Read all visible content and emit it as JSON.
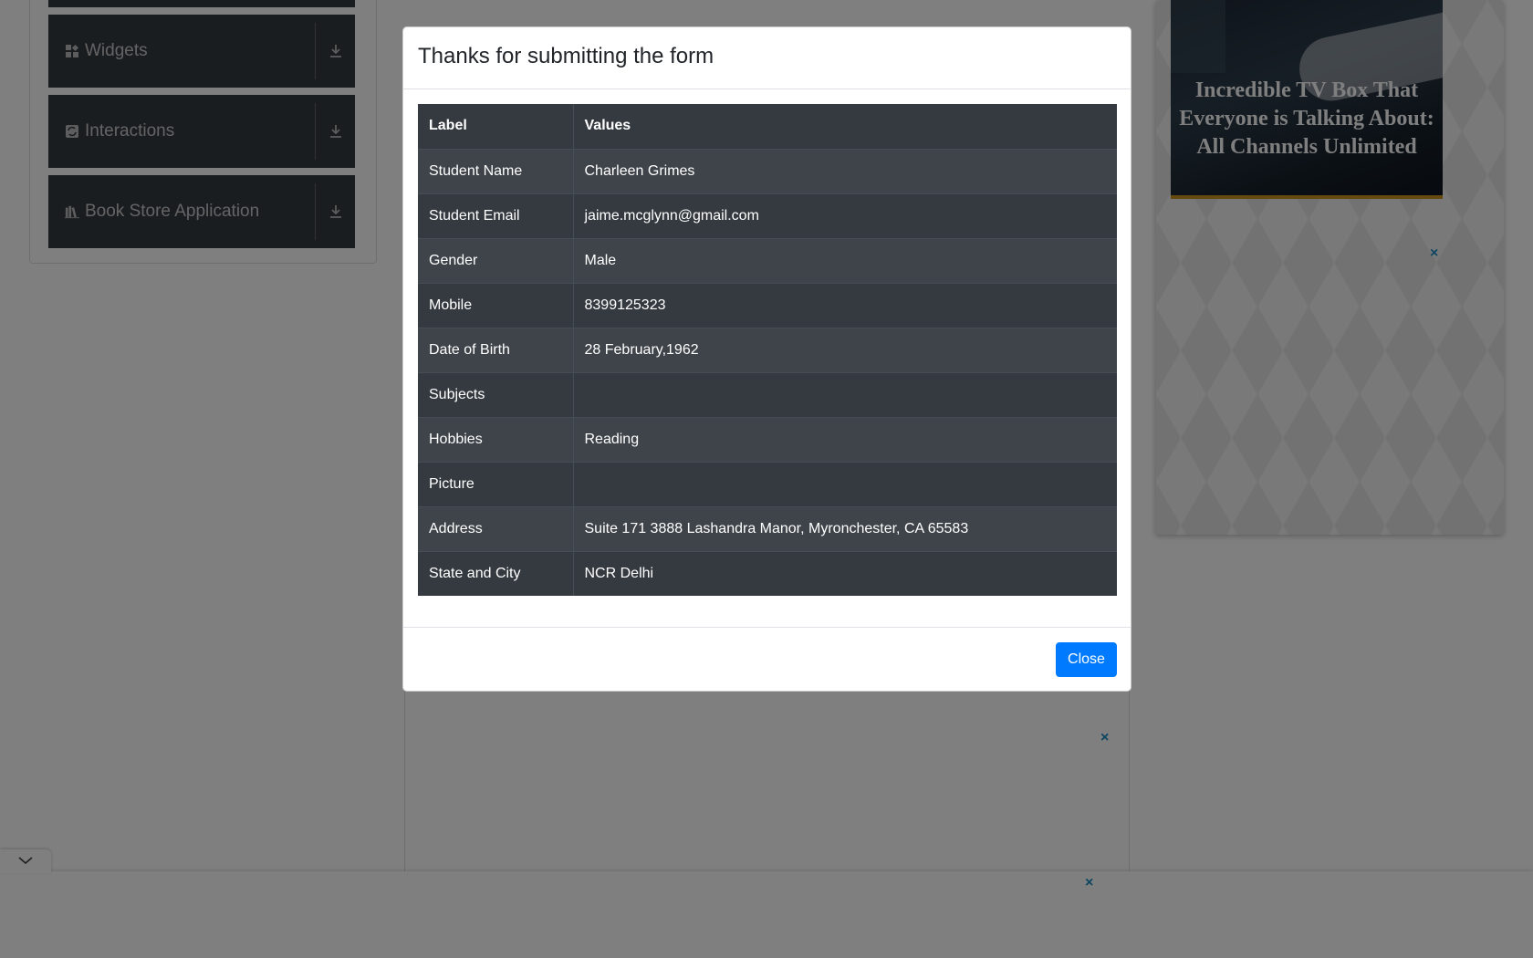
{
  "sidebar": {
    "groups": [
      {
        "label": "Widgets",
        "icon": "widgets-icon"
      },
      {
        "label": "Interactions",
        "icon": "interactions-icon"
      },
      {
        "label": "Book Store Application",
        "icon": "book-store-icon"
      }
    ]
  },
  "ads": {
    "right_caption": "Incredible TV Box That Everyone is Talking About: All Channels Unlimited",
    "close_glyph": "×"
  },
  "modal": {
    "title": "Thanks for submitting the form",
    "columns": [
      "Label",
      "Values"
    ],
    "rows": [
      {
        "label": "Student Name",
        "value": "Charleen Grimes"
      },
      {
        "label": "Student Email",
        "value": "jaime.mcglynn@gmail.com"
      },
      {
        "label": "Gender",
        "value": "Male"
      },
      {
        "label": "Mobile",
        "value": "8399125323"
      },
      {
        "label": "Date of Birth",
        "value": "28 February,1962"
      },
      {
        "label": "Subjects",
        "value": ""
      },
      {
        "label": "Hobbies",
        "value": "Reading"
      },
      {
        "label": "Picture",
        "value": ""
      },
      {
        "label": "Address",
        "value": "Suite 171 3888 Lashandra Manor, Myronchester, CA 65583"
      },
      {
        "label": "State and City",
        "value": "NCR Delhi"
      }
    ],
    "close_label": "Close"
  },
  "colors": {
    "primary": "#007bff",
    "table_dark": "#343a40",
    "ad_close": "#1a8bc3"
  }
}
